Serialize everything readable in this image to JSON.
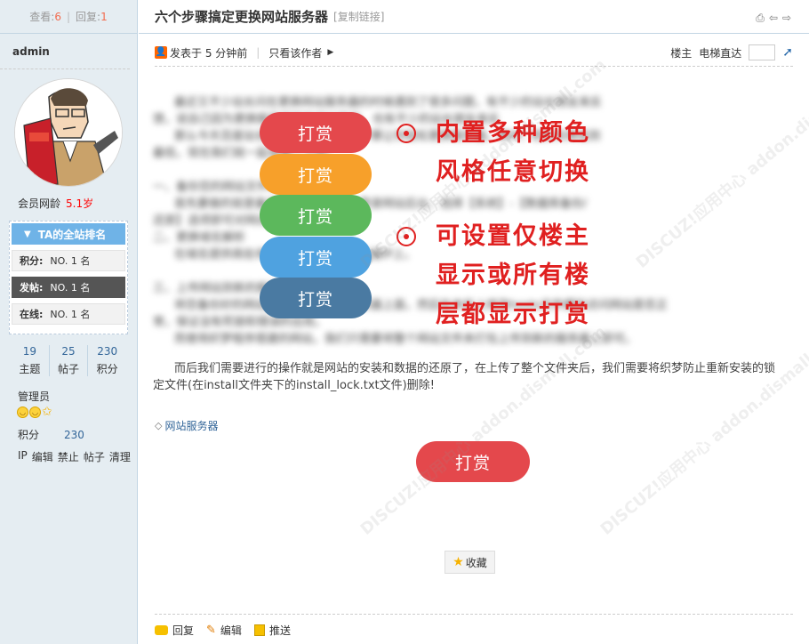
{
  "sidebar": {
    "views_label": "查看:",
    "views": "6",
    "replies_label": "回复:",
    "replies": "1",
    "author": "admin",
    "member_age_label": "会员网龄",
    "member_age": "5.1岁",
    "rank_title": "TA的全站排名",
    "rank_rows": [
      {
        "label": "积分:",
        "value": "NO. 1 名"
      },
      {
        "label": "发帖:",
        "value": "NO. 1 名"
      },
      {
        "label": "在线:",
        "value": "NO. 1 名"
      }
    ],
    "counts": [
      {
        "num": "19",
        "label": "主题"
      },
      {
        "num": "25",
        "label": "帖子"
      },
      {
        "num": "230",
        "label": "积分"
      }
    ],
    "group": "管理员",
    "credit_label": "积分",
    "credit_value": "230",
    "admin_links": [
      "IP",
      "编辑",
      "禁止",
      "帖子",
      "清理"
    ]
  },
  "thread": {
    "title": "六个步骤搞定更换网站服务器",
    "copy_link": "[复制链接]",
    "posted": "发表于 5 分钟前",
    "only_author": "只看该作者",
    "floor_label": "楼主",
    "goto_label": "电梯直达"
  },
  "content": {
    "lines": [
      "最近又不少站长问在更换网站服务器的时候遇到了很多问题，有不少的站长朋友来反",
      "馈，说自己因为更换服务器导致网站降权，也有不少的站长朋友来反",
      "那么今天百度站长就告诉大家，六个步骤让你轻松更换服务器，换IP，把损失降低到",
      "最低，现在我们就一起来看一下吧。",
      "",
      "一、备份您的网站文件和数据库",
      "首先要做的就是备份网站的数据库，登录网站后台，选择【系统】-【数据库备份/",
      "还原】选项即可对网站的数据进行备份。",
      "二、更换域名解析",
      "在域名提供商处将域名解析到新的服务器IP上。",
      "",
      "三、上传网站到新的服务器",
      "将您备份好的网站文件上传到新的服务器上面，然后在本机上修改hosts文件模拟访问网站是否正",
      "常，保证没有死链和错误的出现。",
      "而使用织梦程序搭建的网站，我们只需要将整个网站文件夹打包上传到新的服务器上即可。",
      "而后我们需要进行的操作就是网站的安装和数据的还原了，在上传了整个文件夹后，我们需要将织梦防止重新安装的锁",
      "定文件(在install文件夹下的install_lock.txt文件)删除!"
    ],
    "tag": "网站服务器"
  },
  "overlay": {
    "buttons": [
      "打赏",
      "打赏",
      "打赏",
      "打赏",
      "打赏"
    ],
    "promo1": [
      "内置多种颜色",
      "风格任意切换"
    ],
    "promo2": [
      "可设置仅楼主",
      "显示或所有楼",
      "层都显示打赏"
    ]
  },
  "reward_button": "打赏",
  "favorite_button": "收藏",
  "actions": [
    "回复",
    "编辑",
    "推送"
  ],
  "watermark": "DISCUZ!应用中心 addon.dismall.com",
  "colors": {
    "reward_red": "#e4484c",
    "orange": "#f7a02a",
    "green": "#5cb85c",
    "blue": "#4fa2e0",
    "steel": "#4a7aa2",
    "promo_red": "#e02020",
    "sidebar_bg": "#e5edf2"
  }
}
